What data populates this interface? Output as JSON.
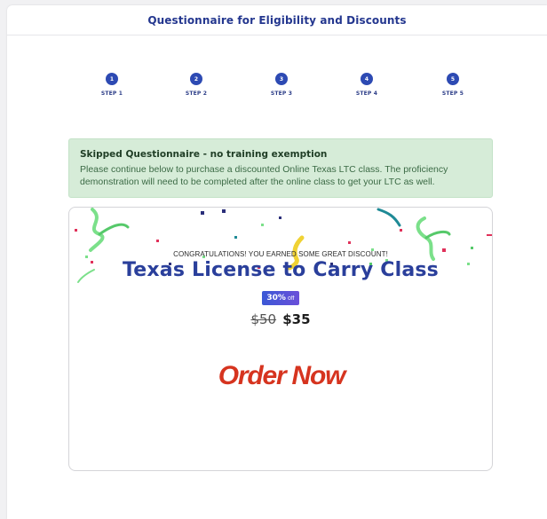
{
  "header": {
    "title": "Questionnaire for Eligibility and Discounts"
  },
  "steps": [
    {
      "number": "1",
      "label": "STEP 1"
    },
    {
      "number": "2",
      "label": "STEP 2"
    },
    {
      "number": "3",
      "label": "STEP 3"
    },
    {
      "number": "4",
      "label": "STEP 4"
    },
    {
      "number": "5",
      "label": "STEP 5"
    }
  ],
  "alert": {
    "title": "Skipped Questionnaire - no training exemption",
    "body": "Please continue below to purchase a discounted Online Texas LTC class. The proficiency demonstration will need to be completed after the online class to get your LTC as well."
  },
  "promo": {
    "congrats": "CONGRATULATIONS! YOU EARNED SOME GREAT DISCOUNT!",
    "course_title": "Texas License to Carry Class",
    "discount_pct": "30%",
    "discount_off": "off",
    "old_price": "$50",
    "new_price": "$35",
    "order_label": "Order Now"
  },
  "colors": {
    "accent": "#2d4ab3",
    "alert_bg": "#d6ecd8",
    "order_red": "#d6341f"
  }
}
